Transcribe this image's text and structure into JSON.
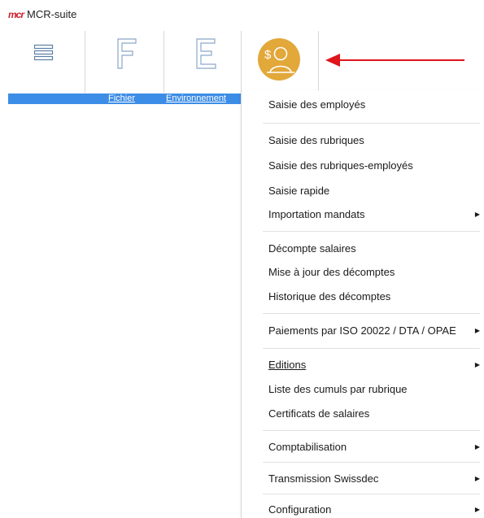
{
  "window": {
    "logo_text": "mcr",
    "title": "MCR-suite"
  },
  "ribbon": {
    "menu_icon": "hamburger-icon",
    "buttons": [
      {
        "letter": "F",
        "label": "Fichier"
      },
      {
        "letter": "E",
        "label": "Environnement"
      }
    ],
    "salary_icon": "salary-person-icon",
    "annotation": "red-arrow-icon"
  },
  "menu": {
    "items": [
      {
        "label": "Saisie des employés",
        "submenu": false
      },
      {
        "label": "Saisie des rubriques",
        "submenu": false
      },
      {
        "label": "Saisie des rubriques-employés",
        "submenu": false
      },
      {
        "label": "Saisie rapide",
        "submenu": false
      },
      {
        "label": "Importation mandats",
        "submenu": true
      },
      {
        "label": "Décompte salaires",
        "submenu": false
      },
      {
        "label": "Mise à jour des décomptes",
        "submenu": false
      },
      {
        "label": "Historique des décomptes",
        "submenu": false
      },
      {
        "label": "Paiements par ISO 20022 / DTA / OPAE",
        "submenu": true
      },
      {
        "label": "Editions",
        "submenu": true
      },
      {
        "label": "Liste des cumuls par rubrique",
        "submenu": false
      },
      {
        "label": "Certificats de salaires",
        "submenu": false
      },
      {
        "label": "Comptabilisation",
        "submenu": true
      },
      {
        "label": "Transmission Swissdec",
        "submenu": true
      },
      {
        "label": "Configuration",
        "submenu": true
      }
    ]
  },
  "colors": {
    "accent_blue": "#3c8de6",
    "salary_gold": "#e2a83a",
    "arrow_red": "#e0141c"
  }
}
